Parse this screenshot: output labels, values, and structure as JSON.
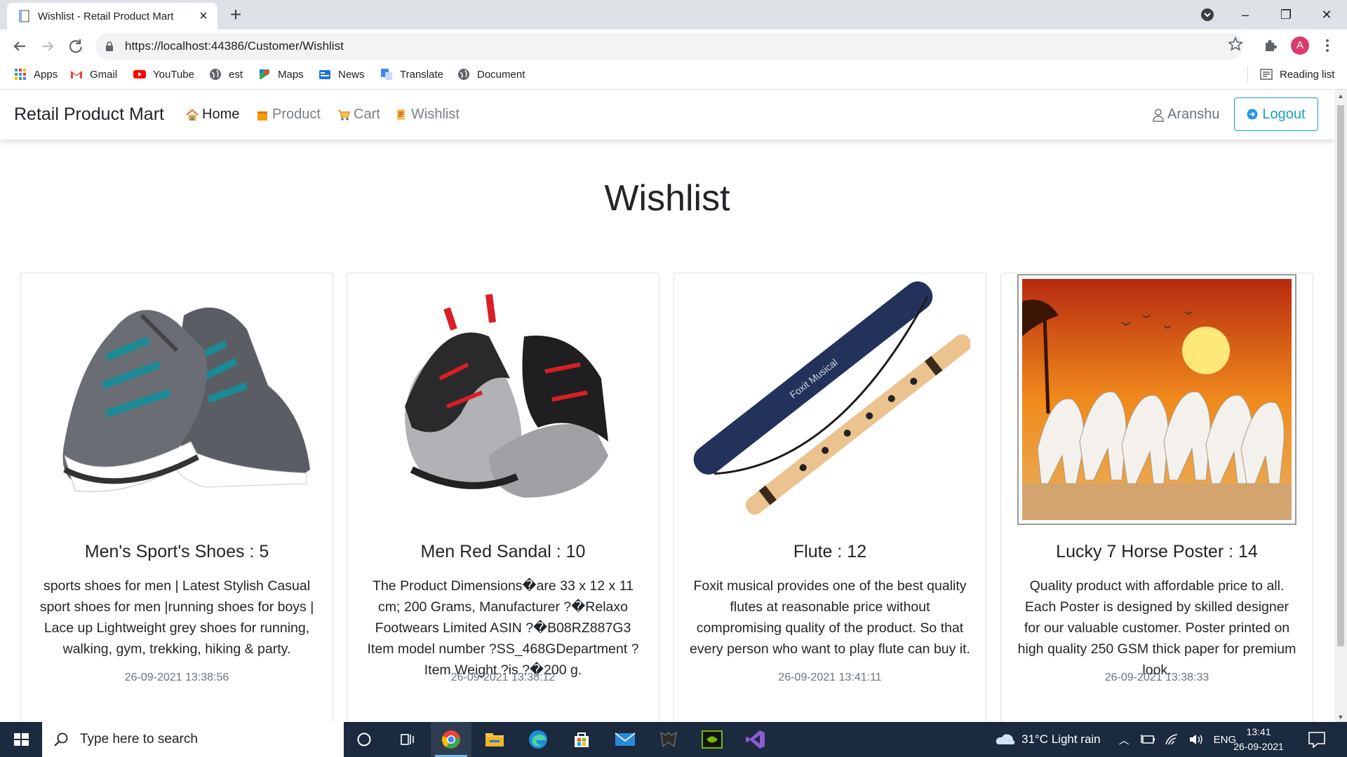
{
  "browser": {
    "tab_title": "Wishlist - Retail Product Mart",
    "url": "https://localhost:44386/Customer/Wishlist",
    "profile_initial": "A",
    "bookmarks": [
      "Apps",
      "Gmail",
      "YouTube",
      "est",
      "Maps",
      "News",
      "Translate",
      "Document"
    ],
    "reading_list": "Reading list"
  },
  "site": {
    "brand": "Retail Product Mart",
    "nav": [
      {
        "label": "Home",
        "active": true
      },
      {
        "label": "Product",
        "active": false
      },
      {
        "label": "Cart",
        "active": false
      },
      {
        "label": "Wishlist",
        "active": false
      }
    ],
    "user": "Aranshu",
    "logout": "Logout"
  },
  "page": {
    "title": "Wishlist",
    "cards": [
      {
        "title": "Men's Sport's Shoes : 5",
        "description": "sports shoes for men | Latest Stylish Casual sport shoes for men |running shoes for boys | Lace up Lightweight grey shoes for running, walking, gym, trekking, hiking & party.",
        "date": "26-09-2021 13:38:56"
      },
      {
        "title": "Men Red Sandal : 10",
        "description": "The Product Dimensions�are 33 x 12 x 11 cm; 200 Grams, Manufacturer ?�Relaxo Footwears Limited ASIN ?�B08RZ887G3 Item model number ?SS_468GDepartment ? Item Weight ?is ?�200 g.",
        "date": "26-09-2021 13:38:12"
      },
      {
        "title": "Flute : 12",
        "description": "Foxit musical provides one of the best quality flutes at reasonable price without compromising quality of the product. So that every person who want to play flute can buy it.",
        "date": "26-09-2021 13:41:11",
        "image_text": "Foxit Musical"
      },
      {
        "title": "Lucky 7 Horse Poster : 14",
        "description": "Quality product with affordable price to all. Each Poster is designed by skilled designer for our valuable customer. Poster printed on high quality 250 GSM thick paper for premium look.",
        "date": "26-09-2021 13:38:33"
      }
    ]
  },
  "taskbar": {
    "search_placeholder": "Type here to search",
    "weather": "31°C  Light rain",
    "language": "ENG",
    "time": "13:41",
    "date": "26-09-2021"
  },
  "colors": {
    "accent_info": "#17a2b8",
    "taskbar": "#1b2a3e",
    "chrome_tabbar": "#dee1e6"
  }
}
